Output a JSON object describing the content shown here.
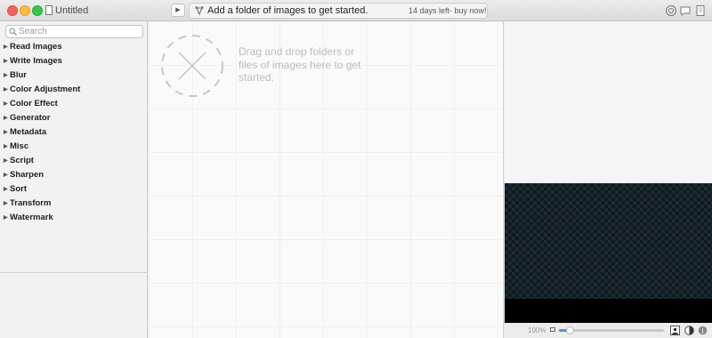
{
  "window": {
    "title": "Untitled"
  },
  "toolbar": {
    "status_message": "Add a folder of images to get started.",
    "trial_text": "14 days left- buy now!"
  },
  "search": {
    "placeholder": "Search"
  },
  "sidebar": {
    "items": [
      {
        "label": "Read Images"
      },
      {
        "label": "Write Images"
      },
      {
        "label": "Blur"
      },
      {
        "label": "Color Adjustment"
      },
      {
        "label": "Color Effect"
      },
      {
        "label": "Generator"
      },
      {
        "label": "Metadata"
      },
      {
        "label": "Misc"
      },
      {
        "label": "Script"
      },
      {
        "label": "Sharpen"
      },
      {
        "label": "Sort"
      },
      {
        "label": "Transform"
      },
      {
        "label": "Watermark"
      }
    ]
  },
  "canvas": {
    "drop_text": "Drag and drop folders or files of images here to get started."
  },
  "preview": {
    "zoom_level": "100%",
    "zoom_slider_fraction": 0.1
  },
  "colors": {
    "close": "#fc605b",
    "minimize": "#fdbc40",
    "zoom": "#34c84a",
    "slider_accent": "#4a90e2"
  },
  "icons": {
    "status": "wizard-hat-icon",
    "play": "play-icon",
    "toolbar_right": [
      "search-icon",
      "speech-bubble-icon",
      "note-icon"
    ],
    "drop_zone": "x-icon",
    "preview_buttons": [
      "image-icon",
      "contrast-icon",
      "info-icon"
    ]
  }
}
